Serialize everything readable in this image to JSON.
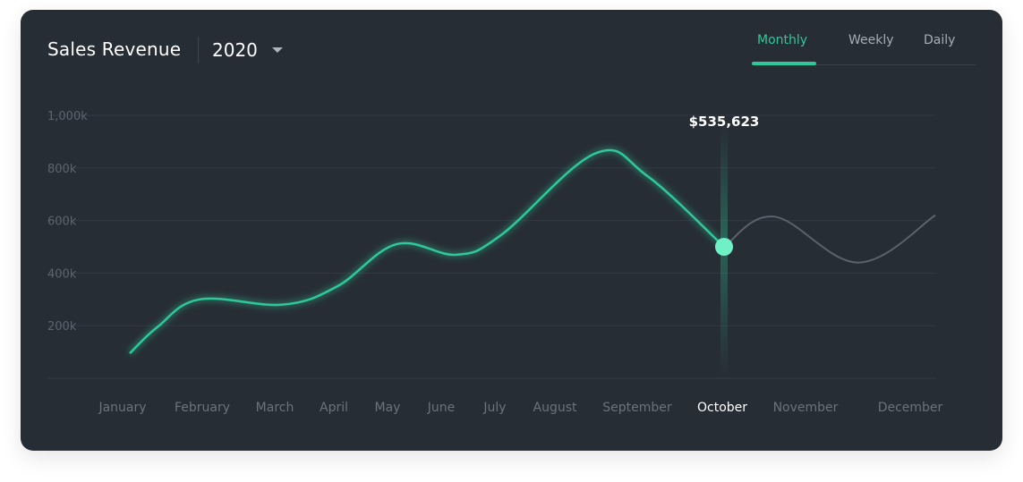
{
  "header": {
    "title": "Sales Revenue",
    "year": "2020",
    "tabs": [
      {
        "label": "Monthly",
        "active": true
      },
      {
        "label": "Weekly",
        "active": false
      },
      {
        "label": "Daily",
        "active": false
      }
    ]
  },
  "colors": {
    "accent": "#2ec99a",
    "marker": "#6ff0c5",
    "future_line": "#5b626c",
    "background": "#272d35"
  },
  "chart_data": {
    "type": "line",
    "title": "Sales Revenue",
    "categories": [
      "January",
      "February",
      "March",
      "April",
      "May",
      "June",
      "July",
      "August",
      "September",
      "October",
      "November",
      "December"
    ],
    "yticks": [
      200000,
      400000,
      600000,
      800000,
      1000000
    ],
    "ytick_labels": [
      "200k",
      "400k",
      "600k",
      "800k",
      "1,000k"
    ],
    "ylim": [
      0,
      1000000
    ],
    "grid": true,
    "series": [
      {
        "x": [
          "January",
          "January–February",
          "February",
          "March",
          "April",
          "May",
          "June",
          "July",
          "August",
          "September",
          "October",
          "November",
          "November–December",
          "December"
        ],
        "values": [
          95000,
          195000,
          300000,
          280000,
          350000,
          510000,
          470000,
          545000,
          855000,
          770000,
          500000,
          615000,
          440000,
          620000
        ]
      }
    ],
    "highlight": {
      "category": "October",
      "index": 10,
      "label": "$535,623"
    }
  }
}
